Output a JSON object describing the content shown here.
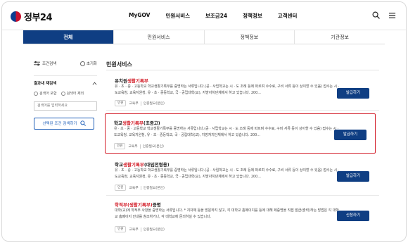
{
  "header": {
    "logo_text": "정부24",
    "nav": [
      "MyGOV",
      "민원서비스",
      "보조금24",
      "정책정보",
      "고객센터"
    ]
  },
  "tabs": [
    "전체",
    "민원서비스",
    "정책정보",
    "기관정보"
  ],
  "filter": {
    "condition_label": "조건검색",
    "reset_label": "초기화",
    "section_title": "결과내 재검색",
    "radio_options": [
      "검색어 포함",
      "검색어 제외"
    ],
    "input_placeholder": "검색어를 입력하세요",
    "search_button": "선택된 조건 검색하기"
  },
  "main": {
    "title": "민원서비스",
    "results": [
      {
        "title_pre": "유치원",
        "title_hl": "생활기록부",
        "title_post": "",
        "desc_pre": "유 · 초 · 중 · 고등학교 학교",
        "desc_hl": "생활기록부",
        "desc_post": "를 증명하는 서류입니다.(공 · 사립학교는 시 · 도 조례 등에 따르며 수수료, 구비 서류 등이 상이할 수 있음) 접수는 시 · 도교육청, 교육지원청, 유 · 초 · 중등학교, 국 · 공립대학(교), 지방자치단체에서 하고 있습니다. 200...",
        "tags": [
          "민원",
          "교육부",
          "인증필요(본인)"
        ],
        "button": "발급하기"
      },
      {
        "title_pre": "학교",
        "title_hl": "생활기록부",
        "title_post": "(초중고)",
        "desc_pre": "유 · 초 · 중 · 고등학교 학교",
        "desc_hl": "생활기록부",
        "desc_post": "를 증명하는 서류입니다.(공 · 사립학교는 시 · 도 조례 등에 따르며 수수료, 구비 서류 등이 상이할 수 있음) 접수는 시 · 도교육청, 교육지원청, 유 · 초 · 중등학교, 국 · 공립대학(교), 지방자치단체에서 하고 있습니다. 200...",
        "tags": [
          "민원",
          "교육부",
          "인증필요(본인)"
        ],
        "button": "발급하기"
      },
      {
        "title_pre": "학교",
        "title_hl": "생활기록부",
        "title_post": "(대입전형용)",
        "desc_pre": "유 · 초 · 중 · 고등학교 학교",
        "desc_hl": "생활기록부",
        "desc_post": "를 증명하는 서류입니다.(공 · 사립학교는 시 · 도 조례 등에 따르며 수수료, 구비 서류 등이 상이할 수 있음) 접수는 시 · 도교육청, 교육지원청, 유 · 초 · 중등학교, 국 · 공립대학(교), 지방자치단체에서 하고 있습니다. 200...",
        "tags": [
          "민원",
          "교육부",
          "인증필요(본인)"
        ],
        "button": "발급하기"
      },
      {
        "title_pre": "",
        "title_hl": "학적부(생활기록부)",
        "title_post": "증명",
        "desc_pre": "",
        "desc_hl": "",
        "desc_post": "대학(교)에 학적부 사항을 증명하는 서류입니다. * 지자체 등을 방문하지 않고, 각 대학교 홈페이지를 등에 대해 제증명을 직접 발급(출력)하는 방법은 각 대학교 홈페이지 안내를 참조하거나, 각 대학교에 문의하실 수 있습니다.",
        "tags": [
          "민원",
          "교육부",
          "인증필요(본인)"
        ],
        "button": "신청하기"
      }
    ]
  }
}
